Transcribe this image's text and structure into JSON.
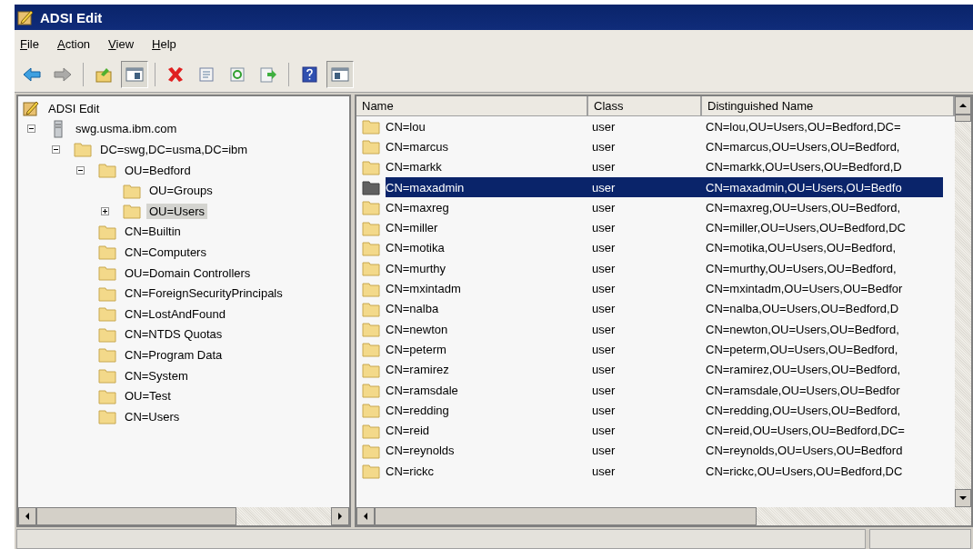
{
  "window": {
    "title": "ADSI Edit"
  },
  "menu": [
    {
      "label": "File"
    },
    {
      "label": "Action"
    },
    {
      "label": "View"
    },
    {
      "label": "Help"
    }
  ],
  "toolbar": [
    {
      "buttons": [
        {
          "kind": "back",
          "pressed": false,
          "disabled": false
        },
        {
          "kind": "forward",
          "pressed": false,
          "disabled": true
        }
      ]
    },
    {
      "buttons": [
        {
          "kind": "up",
          "pressed": false,
          "disabled": false
        },
        {
          "kind": "tree",
          "pressed": true,
          "disabled": false
        }
      ]
    },
    {
      "buttons": [
        {
          "kind": "delete",
          "pressed": false,
          "disabled": false
        },
        {
          "kind": "properties",
          "pressed": false,
          "disabled": false
        },
        {
          "kind": "refresh",
          "pressed": false,
          "disabled": false
        },
        {
          "kind": "export",
          "pressed": false,
          "disabled": false
        }
      ]
    },
    {
      "buttons": [
        {
          "kind": "help",
          "pressed": false,
          "disabled": false
        },
        {
          "kind": "actionpane",
          "pressed": true,
          "disabled": false
        }
      ]
    }
  ],
  "tree": [
    {
      "label": "ADSI Edit",
      "kind": "root",
      "selected": false,
      "children": [
        {
          "label": "swg.usma.ibm.com",
          "kind": "server",
          "expanded": true,
          "selected": false,
          "children": [
            {
              "label": "DC=swg,DC=usma,DC=ibm",
              "kind": "folder",
              "expanded": true,
              "selected": false,
              "children": [
                {
                  "label": "OU=Bedford",
                  "kind": "folder",
                  "expanded": true,
                  "selected": false,
                  "children": [
                    {
                      "label": "OU=Groups",
                      "kind": "folder",
                      "selected": false
                    },
                    {
                      "label": "OU=Users",
                      "kind": "folder",
                      "expanded": false,
                      "selected": true
                    }
                  ]
                },
                {
                  "label": "CN=Builtin",
                  "kind": "folder",
                  "selected": false
                },
                {
                  "label": "CN=Computers",
                  "kind": "folder",
                  "selected": false
                },
                {
                  "label": "OU=Domain Controllers",
                  "kind": "folder",
                  "selected": false
                },
                {
                  "label": "CN=ForeignSecurityPrincipals",
                  "kind": "folder",
                  "selected": false
                },
                {
                  "label": "CN=LostAndFound",
                  "kind": "folder",
                  "selected": false
                },
                {
                  "label": "CN=NTDS Quotas",
                  "kind": "folder",
                  "selected": false
                },
                {
                  "label": "CN=Program Data",
                  "kind": "folder",
                  "selected": false
                },
                {
                  "label": "CN=System",
                  "kind": "folder",
                  "selected": false
                },
                {
                  "label": "OU=Test",
                  "kind": "folder",
                  "selected": false
                },
                {
                  "label": "CN=Users",
                  "kind": "folder",
                  "selected": false
                }
              ]
            }
          ]
        }
      ]
    }
  ],
  "table": {
    "columns": [
      "Name",
      "Class",
      "Distinguished Name"
    ],
    "rows": [
      {
        "name": "CN=lou",
        "class": "user",
        "dn": "CN=lou,OU=Users,OU=Bedford,DC=",
        "selected": false
      },
      {
        "name": "CN=marcus",
        "class": "user",
        "dn": "CN=marcus,OU=Users,OU=Bedford,",
        "selected": false
      },
      {
        "name": "CN=markk",
        "class": "user",
        "dn": "CN=markk,OU=Users,OU=Bedford,D",
        "selected": false
      },
      {
        "name": "CN=maxadmin",
        "class": "user",
        "dn": "CN=maxadmin,OU=Users,OU=Bedfo",
        "selected": true
      },
      {
        "name": "CN=maxreg",
        "class": "user",
        "dn": "CN=maxreg,OU=Users,OU=Bedford,",
        "selected": false
      },
      {
        "name": "CN=miller",
        "class": "user",
        "dn": "CN=miller,OU=Users,OU=Bedford,DC",
        "selected": false
      },
      {
        "name": "CN=motika",
        "class": "user",
        "dn": "CN=motika,OU=Users,OU=Bedford,",
        "selected": false
      },
      {
        "name": "CN=murthy",
        "class": "user",
        "dn": "CN=murthy,OU=Users,OU=Bedford,",
        "selected": false
      },
      {
        "name": "CN=mxintadm",
        "class": "user",
        "dn": "CN=mxintadm,OU=Users,OU=Bedfor",
        "selected": false
      },
      {
        "name": "CN=nalba",
        "class": "user",
        "dn": "CN=nalba,OU=Users,OU=Bedford,D",
        "selected": false
      },
      {
        "name": "CN=newton",
        "class": "user",
        "dn": "CN=newton,OU=Users,OU=Bedford,",
        "selected": false
      },
      {
        "name": "CN=peterm",
        "class": "user",
        "dn": "CN=peterm,OU=Users,OU=Bedford,",
        "selected": false
      },
      {
        "name": "CN=ramirez",
        "class": "user",
        "dn": "CN=ramirez,OU=Users,OU=Bedford,",
        "selected": false
      },
      {
        "name": "CN=ramsdale",
        "class": "user",
        "dn": "CN=ramsdale,OU=Users,OU=Bedfor",
        "selected": false
      },
      {
        "name": "CN=redding",
        "class": "user",
        "dn": "CN=redding,OU=Users,OU=Bedford,",
        "selected": false
      },
      {
        "name": "CN=reid",
        "class": "user",
        "dn": "CN=reid,OU=Users,OU=Bedford,DC=",
        "selected": false
      },
      {
        "name": "CN=reynolds",
        "class": "user",
        "dn": "CN=reynolds,OU=Users,OU=Bedford",
        "selected": false
      },
      {
        "name": "CN=rickc",
        "class": "user",
        "dn": "CN=rickc,OU=Users,OU=Bedford,DC",
        "selected": false
      }
    ]
  }
}
